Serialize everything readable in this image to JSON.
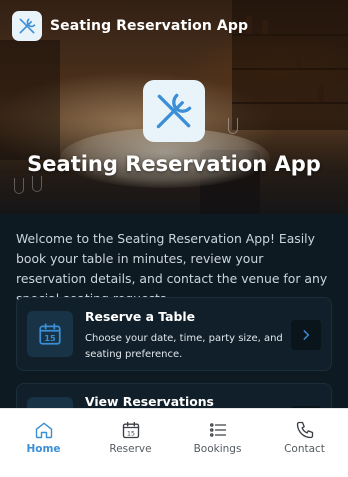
{
  "app_title": "Seating Reservation App",
  "hero": {
    "title": "Seating Reservation App"
  },
  "intro": "Welcome to the Seating Reservation App! Easily book your table in minutes, review your reservation details, and contact the venue for any special seating requests.",
  "cards": [
    {
      "title": "Reserve a Table",
      "description": "Choose your date, time, party size, and seating preference.",
      "icon": "calendar-15-icon",
      "calendar_day": "15"
    },
    {
      "title": "View Reservations",
      "description": "",
      "icon": "list-icon"
    }
  ],
  "nav": {
    "active": "Home",
    "items": [
      {
        "label": "Home",
        "icon": "home-icon"
      },
      {
        "label": "Reserve",
        "icon": "calendar-icon",
        "calendar_day": "15"
      },
      {
        "label": "Bookings",
        "icon": "list-icon"
      },
      {
        "label": "Contact",
        "icon": "phone-icon"
      }
    ]
  },
  "colors": {
    "accent": "#3b8fd6",
    "background": "#0e1a22",
    "card": "#101f29",
    "icon_tile": "#e9f3fa"
  }
}
